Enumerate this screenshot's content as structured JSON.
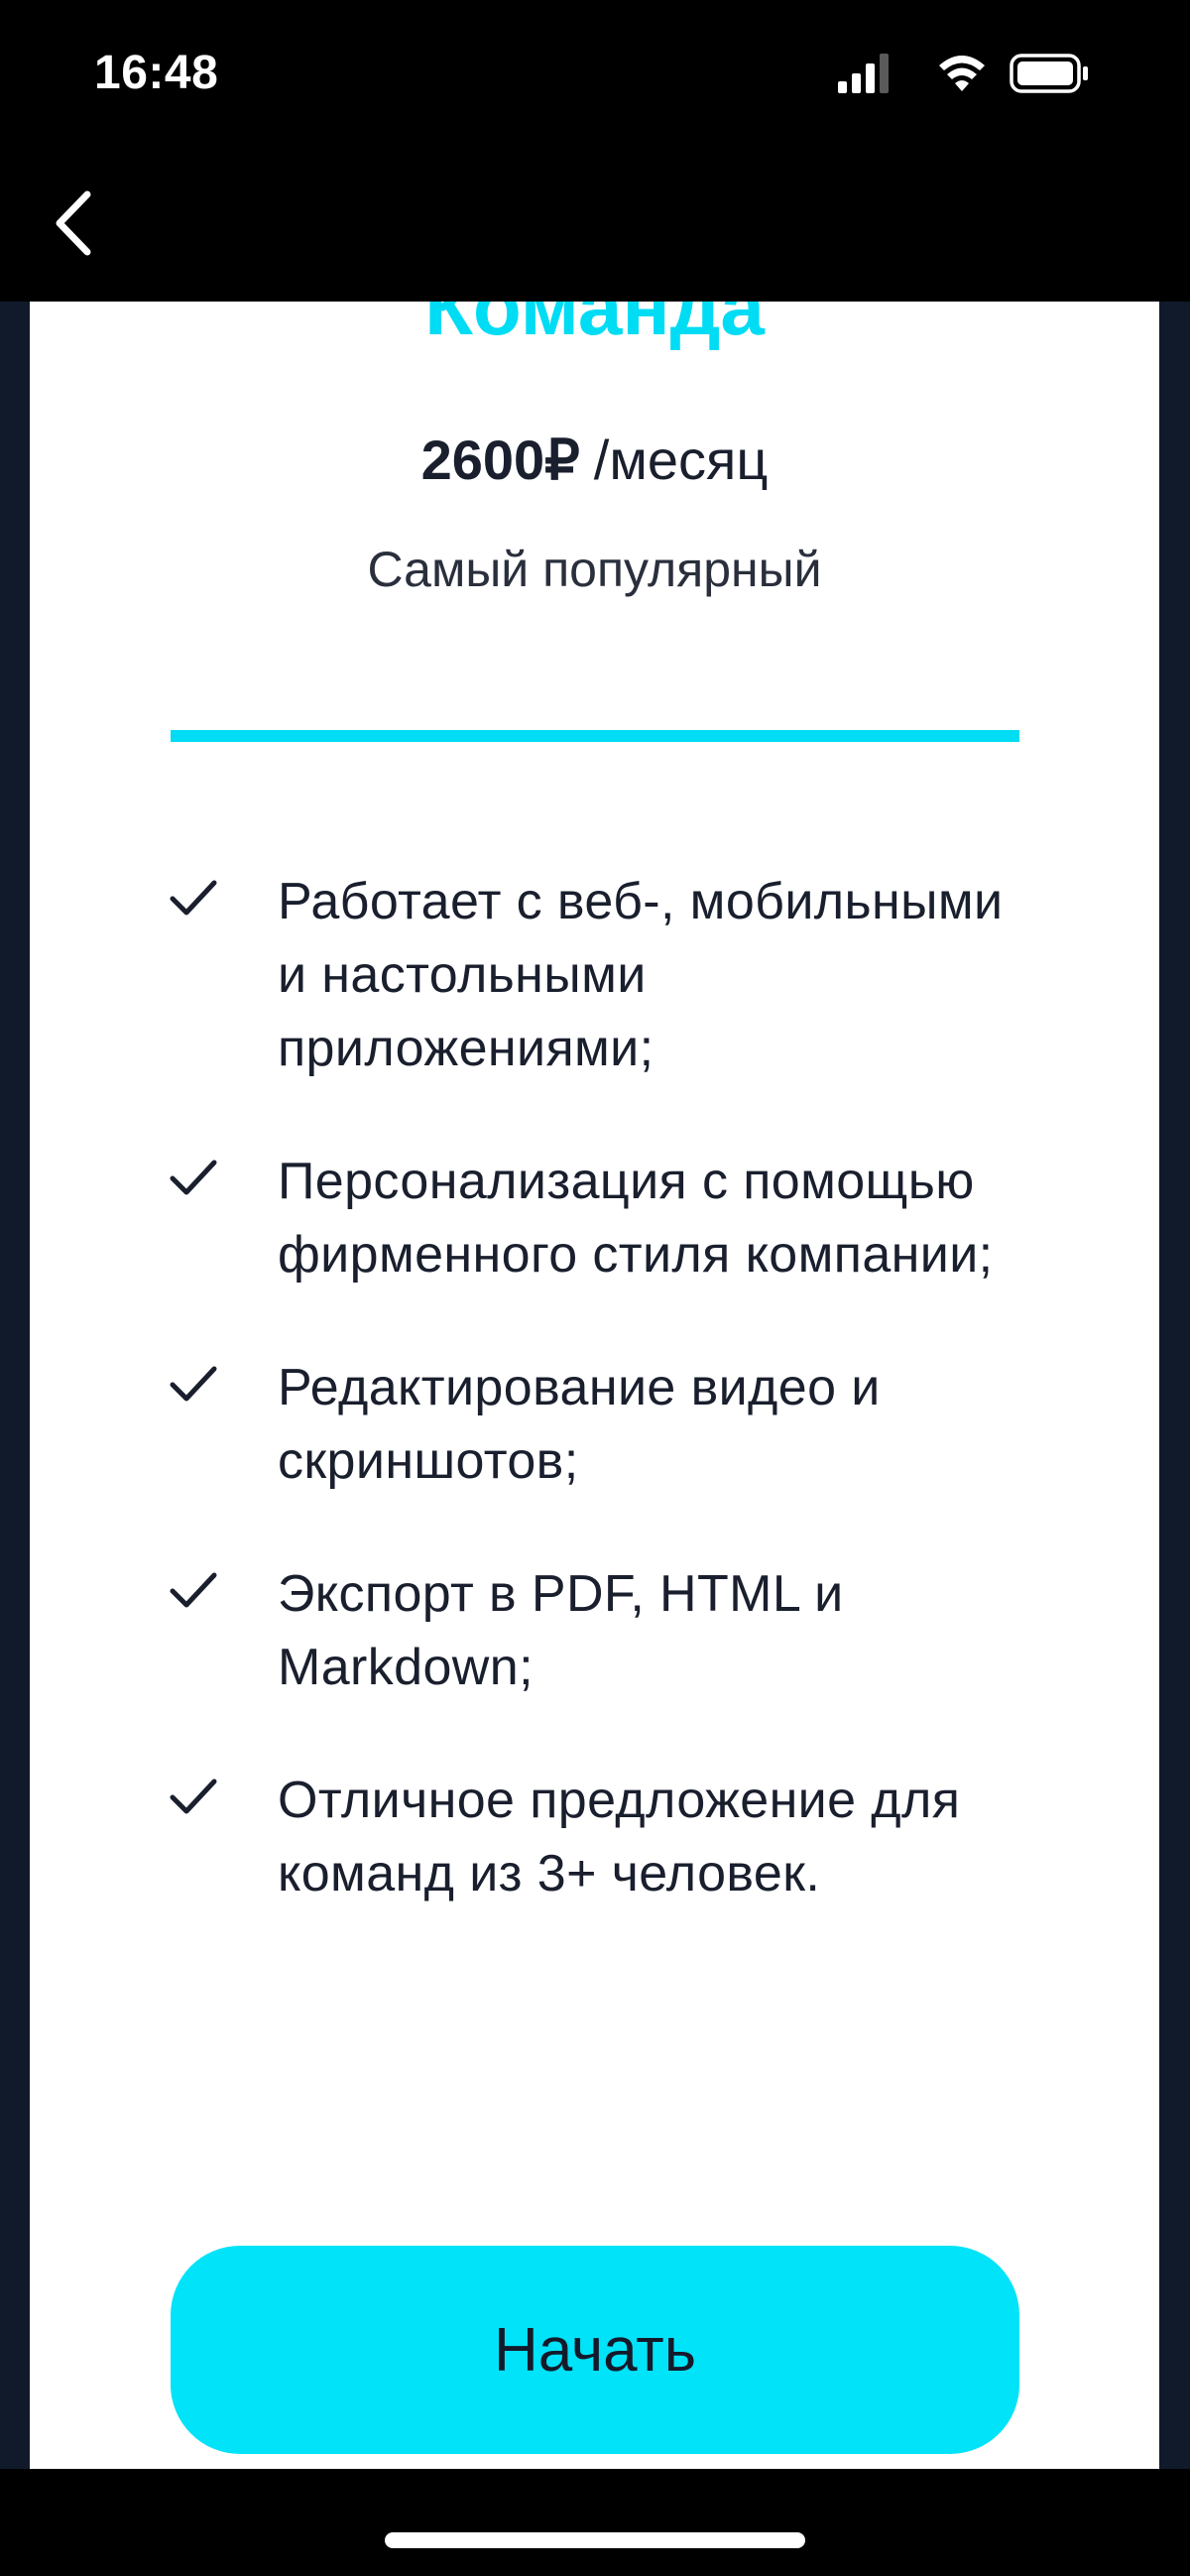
{
  "status_bar": {
    "time": "16:48",
    "icons": [
      "signal-icon",
      "wifi-icon",
      "battery-icon"
    ]
  },
  "nav": {
    "back_icon": "chevron-left-icon"
  },
  "plan": {
    "title": "Команда",
    "price": "2600₽",
    "period": "/месяц",
    "subtitle": "Самый популярный"
  },
  "features": [
    "Работает с веб-, мобильными и настольными приложениями;",
    "Персонализация с помощью фирменного стиля компании;",
    "Редактирование видео и скриншотов;",
    "Экспорт в PDF, HTML и Markdown;",
    "Отличное предложение для команд из 3+ человек."
  ],
  "cta": {
    "label": "Начать"
  },
  "colors": {
    "accent": "#00dcf4",
    "button": "#00e3f8",
    "text": "#1a1f2e",
    "backdrop": "#111a2b"
  }
}
